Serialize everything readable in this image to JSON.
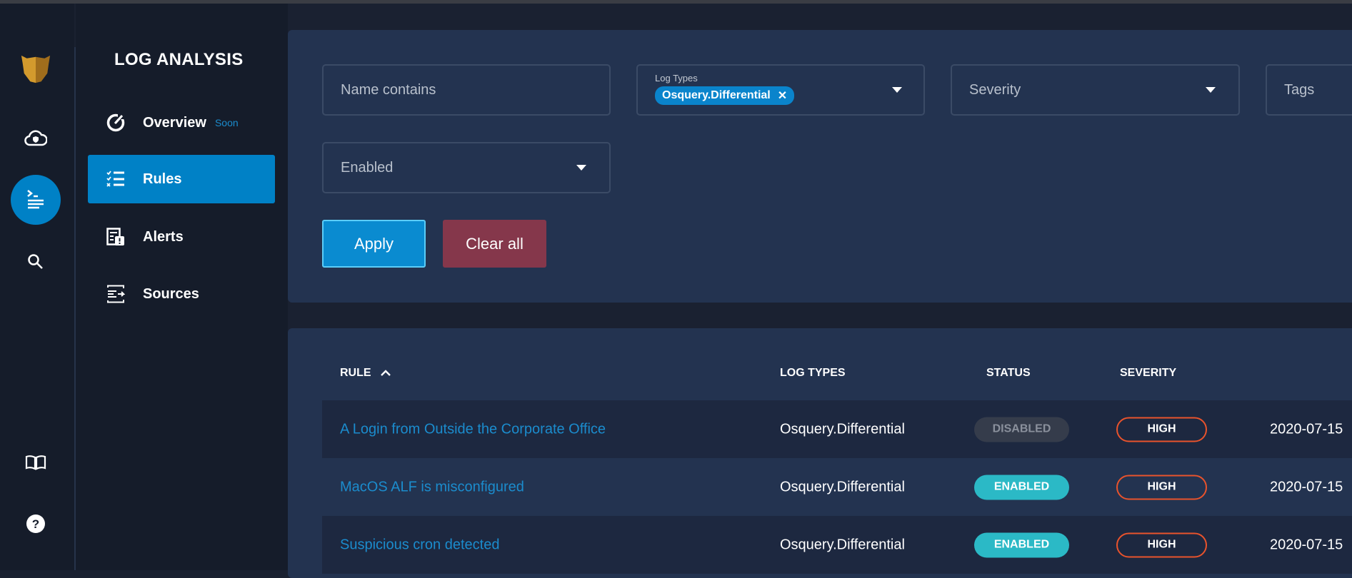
{
  "colors": {
    "accent": "#0081c6",
    "enabled": "#2bb9c6",
    "disabled": "#353c4b",
    "high": "#e9532c",
    "clear": "#85374b",
    "link": "#1b8ccd"
  },
  "rail": {
    "icons": [
      "logo-icon",
      "cloud-shield-icon",
      "terminal-icon",
      "search-icon",
      "book-icon",
      "help-icon"
    ]
  },
  "nav": {
    "title": "LOG ANALYSIS",
    "items": [
      {
        "label": "Overview",
        "badge": "Soon",
        "icon": "gauge-icon"
      },
      {
        "label": "Rules",
        "icon": "checklist-icon",
        "active": true
      },
      {
        "label": "Alerts",
        "icon": "alert-doc-icon"
      },
      {
        "label": "Sources",
        "icon": "source-icon"
      }
    ]
  },
  "filters": {
    "name_placeholder": "Name contains",
    "log_types_label": "Log Types",
    "log_types_chip": "Osquery.Differential",
    "severity_placeholder": "Severity",
    "tags_placeholder": "Tags",
    "enabled_placeholder": "Enabled",
    "apply": "Apply",
    "clear": "Clear all"
  },
  "table": {
    "headers": {
      "rule": "RULE",
      "log_types": "LOG TYPES",
      "status": "STATUS",
      "severity": "SEVERITY"
    },
    "rows": [
      {
        "rule": "A Login from Outside the Corporate Office",
        "log_type": "Osquery.Differential",
        "status": "DISABLED",
        "severity": "HIGH",
        "date": "2020-07-15"
      },
      {
        "rule": "MacOS ALF is misconfigured",
        "log_type": "Osquery.Differential",
        "status": "ENABLED",
        "severity": "HIGH",
        "date": "2020-07-15"
      },
      {
        "rule": "Suspicious cron detected",
        "log_type": "Osquery.Differential",
        "status": "ENABLED",
        "severity": "HIGH",
        "date": "2020-07-15"
      }
    ]
  }
}
